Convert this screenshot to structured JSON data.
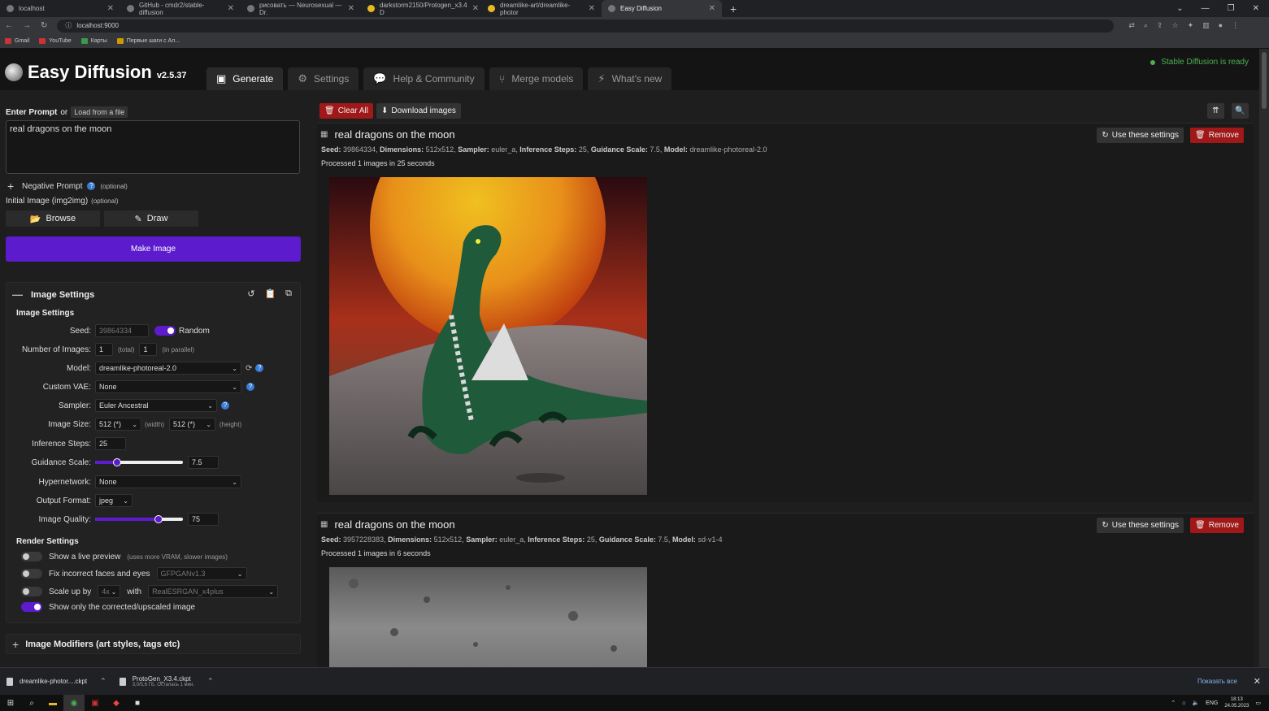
{
  "browser": {
    "tabs": [
      {
        "label": "localhost"
      },
      {
        "label": "GitHub - cmdr2/stable-diffusion"
      },
      {
        "label": "рисовать — Neurosexual — Dr."
      },
      {
        "label": "darkstorm2150/Protogen_x3.4 D"
      },
      {
        "label": "dreamlike-art/dreamlike-photor"
      },
      {
        "label": "Easy Diffusion"
      }
    ],
    "url": "localhost:9000",
    "bookmarks": [
      {
        "label": "Gmail"
      },
      {
        "label": "YouTube"
      },
      {
        "label": "Карты"
      },
      {
        "label": "Первые шаги с Ал..."
      }
    ]
  },
  "app": {
    "name": "Easy Diffusion",
    "version": "v2.5.37",
    "status": "Stable Diffusion is ready",
    "nav": [
      {
        "label": "Generate",
        "icon": "image-icon"
      },
      {
        "label": "Settings",
        "icon": "gear-icon"
      },
      {
        "label": "Help & Community",
        "icon": "comments-icon"
      },
      {
        "label": "Merge models",
        "icon": "merge-icon"
      },
      {
        "label": "What's new",
        "icon": "bolt-icon"
      }
    ]
  },
  "left": {
    "prompt_label": "Enter Prompt",
    "or": "or",
    "load_file": "Load from a file",
    "prompt": "real dragons on the moon",
    "negative_label": "Negative Prompt",
    "optional": "(optional)",
    "initial_image": "Initial Image (img2img)",
    "browse": "Browse",
    "draw": "Draw",
    "make_image": "Make Image",
    "image_settings_title": "Image Settings",
    "image_settings_sub": "Image Settings",
    "seed_label": "Seed:",
    "seed": "39864334",
    "random": "Random",
    "num_images_label": "Number of Images:",
    "num_total": "1",
    "total_hint": "(total)",
    "num_parallel": "1",
    "parallel_hint": "(in parallel)",
    "model_label": "Model:",
    "model": "dreamlike-photoreal-2.0",
    "vae_label": "Custom VAE:",
    "vae": "None",
    "sampler_label": "Sampler:",
    "sampler": "Euler Ancestral",
    "size_label": "Image Size:",
    "width": "512 (*)",
    "width_hint": "(width)",
    "height": "512 (*)",
    "height_hint": "(height)",
    "steps_label": "Inference Steps:",
    "steps": "25",
    "guidance_label": "Guidance Scale:",
    "guidance": "7.5",
    "guidance_fraction": 0.25,
    "hypernetwork_label": "Hypernetwork:",
    "hypernetwork": "None",
    "format_label": "Output Format:",
    "format": "jpeg",
    "quality_label": "Image Quality:",
    "quality": "75",
    "quality_fraction": 0.72,
    "render_settings": "Render Settings",
    "live_preview": "Show a live preview",
    "live_preview_hint": "(uses more VRAM, slower images)",
    "fix_faces": "Fix incorrect faces and eyes",
    "fix_faces_model": "GFPGANv1.3",
    "scale_up": "Scale up by",
    "scale_factor": "4x",
    "with": "with",
    "upscaler": "RealESRGAN_x4plus",
    "show_corrected": "Show only the corrected/upscaled image",
    "modifiers": "Image Modifiers (art styles, tags etc)"
  },
  "right": {
    "clear_all": "Clear All",
    "download_images": "Download images",
    "use_settings": "Use these settings",
    "remove": "Remove",
    "results": [
      {
        "prompt": "real dragons on the moon",
        "seed": "39864334",
        "dimensions": "512x512",
        "sampler": "euler_a",
        "steps": "25",
        "guidance": "7.5",
        "model": "dreamlike-photoreal-2.0",
        "processed": "Processed 1 images in 25 seconds"
      },
      {
        "prompt": "real dragons on the moon",
        "seed": "3957228383",
        "dimensions": "512x512",
        "sampler": "euler_a",
        "steps": "25",
        "guidance": "7.5",
        "model": "sd-v1-4",
        "processed": "Processed 1 images in 6 seconds"
      }
    ],
    "meta_labels": {
      "seed": "Seed:",
      "dimensions": "Dimensions:",
      "sampler": "Sampler:",
      "steps": "Inference Steps:",
      "guidance": "Guidance Scale:",
      "model": "Model:"
    }
  },
  "downloads": {
    "items": [
      {
        "name": "dreamlike-photor....ckpt",
        "sub": ""
      },
      {
        "name": "ProtoGen_X3.4.ckpt",
        "sub": "3,0/5,6 ГБ, Осталась 1 мин."
      }
    ],
    "show_all": "Показать все"
  },
  "taskbar": {
    "lang": "ENG",
    "time": "18:13",
    "date": "24.05.2023"
  },
  "colors": {
    "accent": "#5c1bcc",
    "danger": "#a01818",
    "ready": "#4caf50"
  }
}
